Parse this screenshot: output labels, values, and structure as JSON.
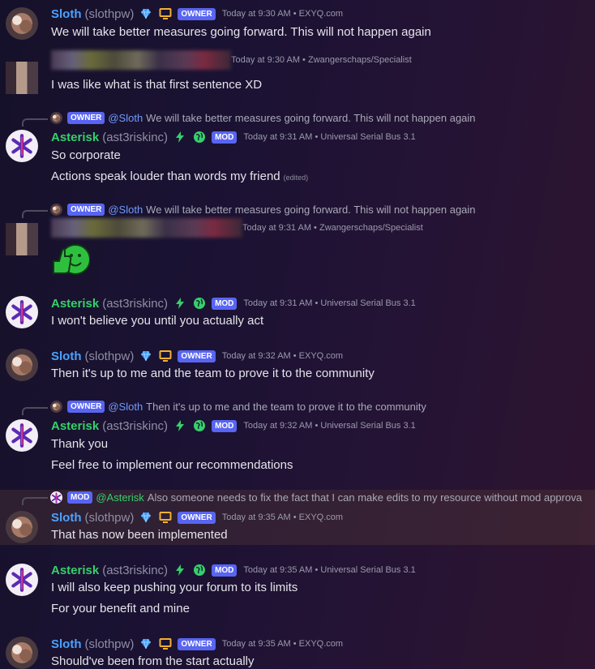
{
  "users": {
    "sloth": {
      "name": "Sloth",
      "username": "(slothpw)",
      "badge": "OWNER",
      "server": "EXYQ.com"
    },
    "asterisk": {
      "name": "Asterisk",
      "username": "(ast3riskinc)",
      "badge": "MOD",
      "server": "Universal Serial Bus 3.1"
    },
    "blurred": {
      "server": "Zwangerschaps/Specialist"
    }
  },
  "colors": {
    "sloth_name": "#4aa2ff",
    "asterisk_name": "#35d06a",
    "badge_bg": "#5865f2",
    "mention": "#6f9cff"
  },
  "icons": [
    "diamond-icon",
    "monitor-icon",
    "bolt-icon",
    "globe-icon",
    "thumbs-up-emoji"
  ],
  "messages": [
    {
      "time": "Today at 9:30 AM",
      "lines": [
        "We will take better measures going forward. This will not happen again"
      ]
    },
    {
      "time": "Today at 9:30 AM",
      "lines": [
        "I was like what is that first sentence XD"
      ]
    },
    {
      "reply": {
        "badge": "OWNER",
        "mention": "@Sloth",
        "text": "We will take better measures going forward. This will not happen again"
      },
      "time": "Today at 9:31 AM",
      "lines": [
        "So corporate",
        "Actions speak louder than words my friend"
      ],
      "edited": "(edited)"
    },
    {
      "reply": {
        "badge": "OWNER",
        "mention": "@Sloth",
        "text": "We will take better measures going forward. This will not happen again"
      },
      "time": "Today at 9:31 AM"
    },
    {
      "time": "Today at 9:31 AM",
      "lines": [
        "I won't believe you until you actually act"
      ]
    },
    {
      "time": "Today at 9:32 AM",
      "lines": [
        "Then it's up to me and the team to prove it to the community"
      ]
    },
    {
      "reply": {
        "badge": "OWNER",
        "mention": "@Sloth",
        "text": "Then it's up to me and the team to prove it to the community"
      },
      "time": "Today at 9:32 AM",
      "lines": [
        "Thank you",
        "Feel free to implement our recommendations"
      ]
    },
    {
      "reply": {
        "badge": "MOD",
        "mention": "@Asterisk",
        "text": "Also someone needs to fix the fact that I can make edits to my resource without mod approva"
      },
      "time": "Today at 9:35 AM",
      "lines": [
        "That has now been implemented"
      ]
    },
    {
      "time": "Today at 9:35 AM",
      "lines": [
        "I will also keep pushing your forum to its limits",
        "For your benefit and mine"
      ]
    },
    {
      "time": "Today at 9:35 AM",
      "lines": [
        "Should've been from the start actually"
      ]
    }
  ]
}
